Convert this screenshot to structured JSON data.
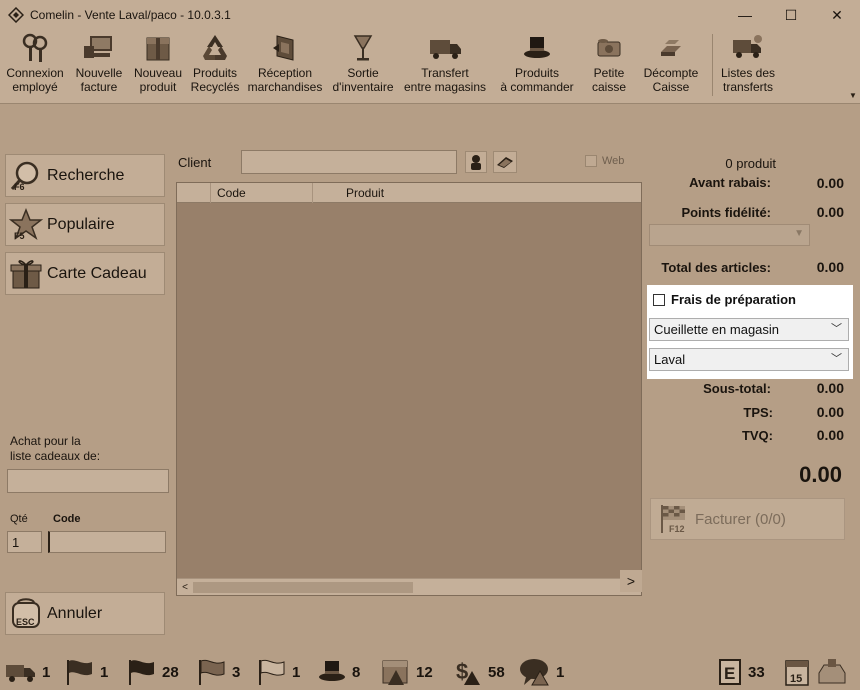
{
  "window": {
    "title": "Comelin - Vente Laval/paco - 10.0.3.1",
    "minimize": "—",
    "maximize": "☐",
    "close": "✕"
  },
  "toolbar": [
    {
      "line1": "Connexion",
      "line2": "employé",
      "icon": "keys-icon"
    },
    {
      "line1": "Nouvelle",
      "line2": "facture",
      "icon": "computer-icon"
    },
    {
      "line1": "Nouveau",
      "line2": "produit",
      "icon": "box-icon"
    },
    {
      "line1": "Produits",
      "line2": "Recyclés",
      "icon": "recycle-icon"
    },
    {
      "line1": "Réception",
      "line2": "marchandises",
      "icon": "receive-box-icon"
    },
    {
      "line1": "Sortie",
      "line2": "d'inventaire",
      "icon": "glass-icon"
    },
    {
      "line1": "Transfert",
      "line2": "entre magasins",
      "icon": "truck-icon"
    },
    {
      "line1": "Produits",
      "line2": "à commander",
      "icon": "magic-hat-icon"
    },
    {
      "line1": "Petite",
      "line2": "caisse",
      "icon": "cash-icon"
    },
    {
      "line1": "Décompte",
      "line2": "Caisse",
      "icon": "gold-bars-icon"
    },
    {
      "line1": "Listes des",
      "line2": "transferts",
      "icon": "truck-list-icon"
    }
  ],
  "left": {
    "search_btn": "Recherche",
    "search_key": "F6",
    "popular_btn": "Populaire",
    "popular_key": "F5",
    "gift_card_btn": "Carte Cadeau",
    "gift_list_label_1": "Achat pour la",
    "gift_list_label_2": "liste cadeaux de:",
    "qty_label": "Qté",
    "code_label": "Code",
    "qty_value": "1",
    "cancel_btn": "Annuler",
    "cancel_key": "ESC"
  },
  "center": {
    "client_label": "Client",
    "web_label": "Web",
    "columns": [
      "",
      "Code",
      "Produit"
    ]
  },
  "summary": {
    "product_count": "0 produit",
    "avant_rabais_label": "Avant rabais:",
    "avant_rabais_value": "0.00",
    "points_label": "Points fidélité:",
    "points_value": "0.00",
    "total_articles_label": "Total des articles:",
    "total_articles_value": "0.00",
    "prep_label": "Frais de préparation",
    "pickup_option": "Cueillette en magasin",
    "store_option": "Laval",
    "sous_total_label": "Sous-total:",
    "sous_total_value": "0.00",
    "tps_label": "TPS:",
    "tps_value": "0.00",
    "tvq_label": "TVQ:",
    "tvq_value": "0.00",
    "grand_total": "0.00",
    "invoice_btn": "Facturer (0/0)",
    "invoice_key": "F12"
  },
  "status_bar": [
    {
      "icon": "truck-icon",
      "count": "1"
    },
    {
      "icon": "flag-icon",
      "count": "1"
    },
    {
      "icon": "flag-icon",
      "count": "28"
    },
    {
      "icon": "flag-outline-icon",
      "count": "3"
    },
    {
      "icon": "flag-white-icon",
      "count": "1"
    },
    {
      "icon": "magic-hat-icon",
      "count": "8"
    },
    {
      "icon": "box-warning-icon",
      "count": "12"
    },
    {
      "icon": "money-warning-icon",
      "count": "58"
    },
    {
      "icon": "chat-warning-icon",
      "count": "1"
    },
    {
      "icon": "e-badge-icon",
      "count": "33"
    },
    {
      "icon": "calendar-icon",
      "count": "15"
    }
  ]
}
